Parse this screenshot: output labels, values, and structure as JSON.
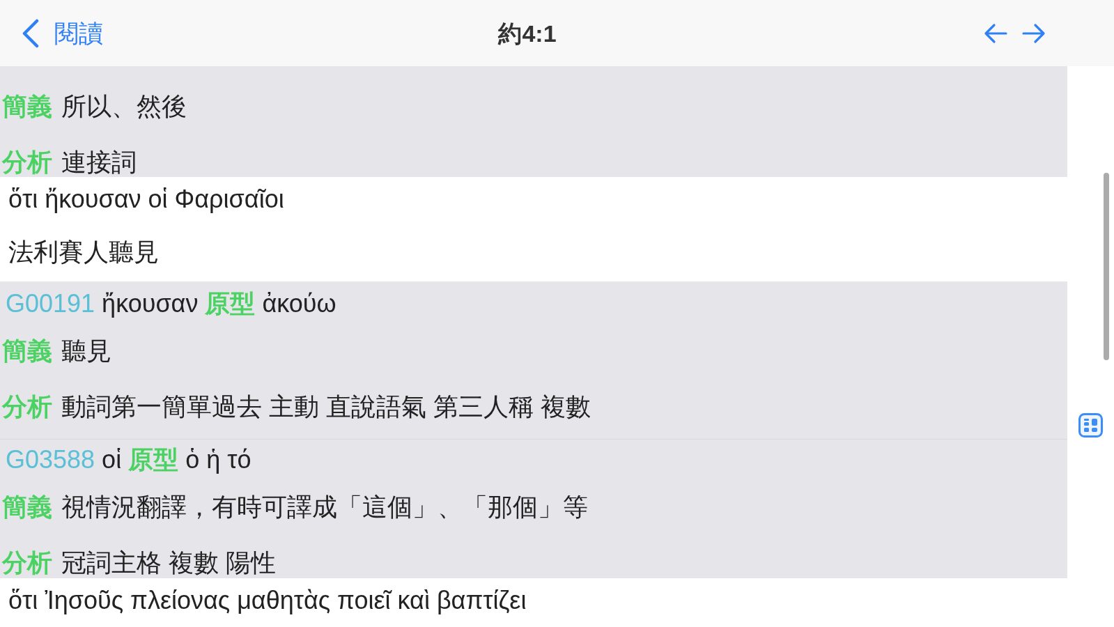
{
  "nav_bar": {
    "back_label": "閱讀",
    "title": "約4:1"
  },
  "sections": [
    {
      "kind": "analysis",
      "entries": [
        {
          "gloss_label": "簡義",
          "gloss": "所以、然後",
          "parsing_label": "分析",
          "parsing": "連接詞"
        }
      ]
    },
    {
      "kind": "verse",
      "greek": "ὅτι ἤκουσαν οἱ Φαρισαῖοι",
      "translation": "法利賽人聽見"
    },
    {
      "kind": "analysis",
      "entries": [
        {
          "strong": "G00191",
          "word": "ἤκουσαν",
          "lemma_label": "原型",
          "lemma": "ἀκούω",
          "gloss_label": "簡義",
          "gloss": "聽見",
          "parsing_label": "分析",
          "parsing": "動詞第一簡單過去 主動 直說語氣 第三人稱 複數"
        },
        {
          "strong": "G03588",
          "word": "οἱ",
          "lemma_label": "原型",
          "lemma": "ὁ ἡ τό",
          "gloss_label": "簡義",
          "gloss": "視情況翻譯，有時可譯成「這個」、「那個」等",
          "parsing_label": "分析",
          "parsing": "冠詞主格 複數 陽性"
        }
      ]
    },
    {
      "kind": "verse",
      "greek": "ὅτι Ἰησοῦς πλείονας μαθητὰς ποιεῖ καὶ βαπτίζει"
    }
  ]
}
